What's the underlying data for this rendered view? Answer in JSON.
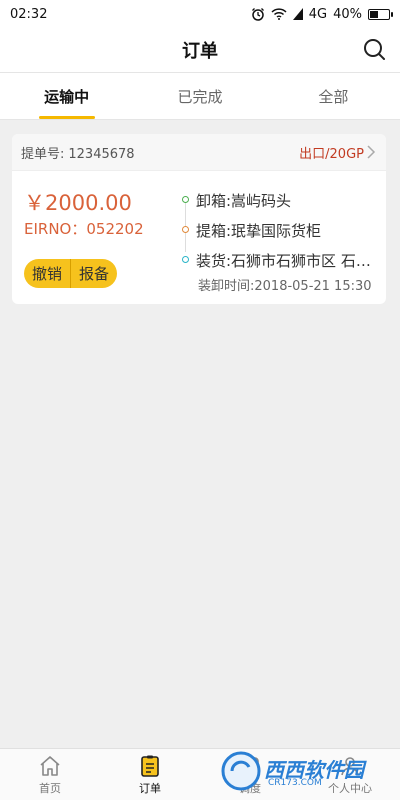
{
  "status_bar": {
    "time": "02:32",
    "network": "4G",
    "battery": "40%",
    "battery_level": 0.4
  },
  "header": {
    "title": "订单"
  },
  "tabs": [
    {
      "label": "运输中",
      "active": true
    },
    {
      "label": "已完成",
      "active": false
    },
    {
      "label": "全部",
      "active": false
    }
  ],
  "order": {
    "order_no_label": "提单号:",
    "order_no": "12345678",
    "cargo_type": "出口/20GP",
    "price": "￥2000.00",
    "eirno": "EIRNO：052202",
    "actions": {
      "cancel": "撤销",
      "report": "报备"
    },
    "stops": [
      {
        "text": "卸箱:嵩屿码头",
        "color": "#4caf50"
      },
      {
        "text": "提箱:珉挚国际货柜",
        "color": "#e08a3c"
      },
      {
        "text": "装货:石狮市石狮市区 石狮市",
        "color": "#2bb5c8"
      }
    ],
    "load_time": "装卸时间:2018-05-21 15:30"
  },
  "bottom_nav": [
    {
      "label": "首页",
      "icon": "home-icon",
      "active": false
    },
    {
      "label": "订单",
      "icon": "order-icon",
      "active": true
    },
    {
      "label": "调度",
      "icon": "dispatch-icon",
      "active": false
    },
    {
      "label": "个人中心",
      "icon": "profile-icon",
      "active": false
    }
  ],
  "watermark": {
    "title": "西西软件园",
    "subtitle": "CR173.COM"
  },
  "colors": {
    "accent": "#f6c21d",
    "price": "#d9623a",
    "cargo": "#c23b22"
  }
}
